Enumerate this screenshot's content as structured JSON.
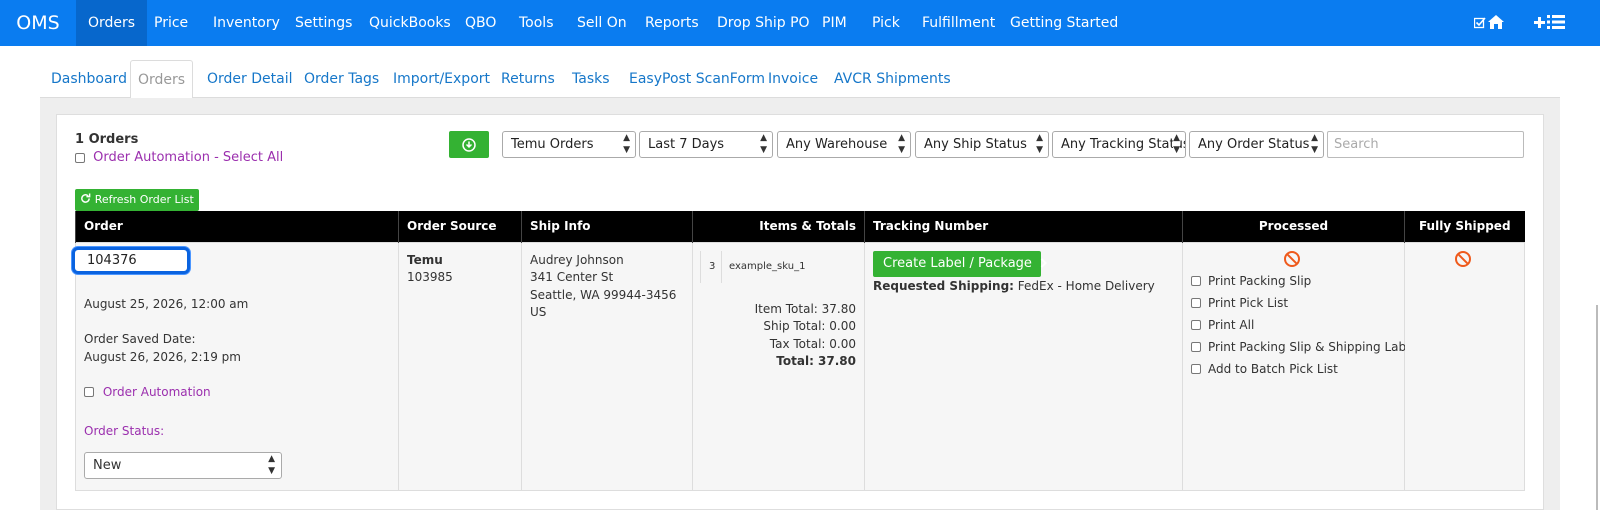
{
  "topnav": {
    "brand": "OMS",
    "items": [
      "Orders",
      "Price",
      "Inventory",
      "Settings",
      "QuickBooks",
      "QBO",
      "Tools",
      "Sell On",
      "Reports",
      "Drop Ship PO",
      "PIM",
      "Pick",
      "Fulfillment",
      "Getting Started"
    ],
    "active": "Orders",
    "right_icons": [
      "check-square-icon",
      "home-icon",
      "plus-icon",
      "list-icon"
    ],
    "color": "#0a7cf0"
  },
  "subtabs": {
    "items": [
      "Dashboard",
      "Orders",
      "Order Detail",
      "Order Tags",
      "Import/Export",
      "Returns",
      "Tasks",
      "EasyPost ScanForm",
      "Invoice",
      "AVCR Shipments"
    ],
    "active": "Orders"
  },
  "toolbar": {
    "count_label": "1 Orders",
    "automation_select_all": "Order Automation - Select All",
    "download_icon": "download-icon",
    "filters": [
      "Temu Orders",
      "Last 7 Days",
      "Any Warehouse",
      "Any Ship Status",
      "Any Tracking Status",
      "Any Order Status"
    ],
    "search_placeholder": "Search",
    "refresh_label": "Refresh Order List"
  },
  "table": {
    "headers": [
      "Order",
      "Order Source",
      "Ship Info",
      "Items & Totals",
      "Tracking Number",
      "Processed",
      "Fully Shipped"
    ],
    "row": {
      "order_number": "104376",
      "order_date": "August 25, 2026, 12:00 am",
      "saved_label": "Order Saved Date:",
      "saved_date": "August 26, 2026, 2:19 pm",
      "automation_label": "Order Automation",
      "status_label": "Order Status:",
      "status_value": "New",
      "source_name": "Temu",
      "source_id": "103985",
      "ship_name": "Audrey Johnson",
      "ship_street": "341 Center St",
      "ship_city": "Seattle, WA 99944-3456",
      "ship_country": "US",
      "item_qty": "3",
      "item_sku": "example_sku_1",
      "item_total": "Item Total: 37.80",
      "ship_total": "Ship Total: 0.00",
      "tax_total": "Tax Total: 0.00",
      "total": "Total: 37.80",
      "label_button": "Create Label / Package",
      "requested_label": "Requested Shipping:",
      "requested_value": "FedEx - Home Delivery",
      "processed_options": [
        "Print Packing Slip",
        "Print Pick List",
        "Print All",
        "Print Packing Slip & Shipping Label",
        "Add to Batch Pick List"
      ]
    }
  }
}
